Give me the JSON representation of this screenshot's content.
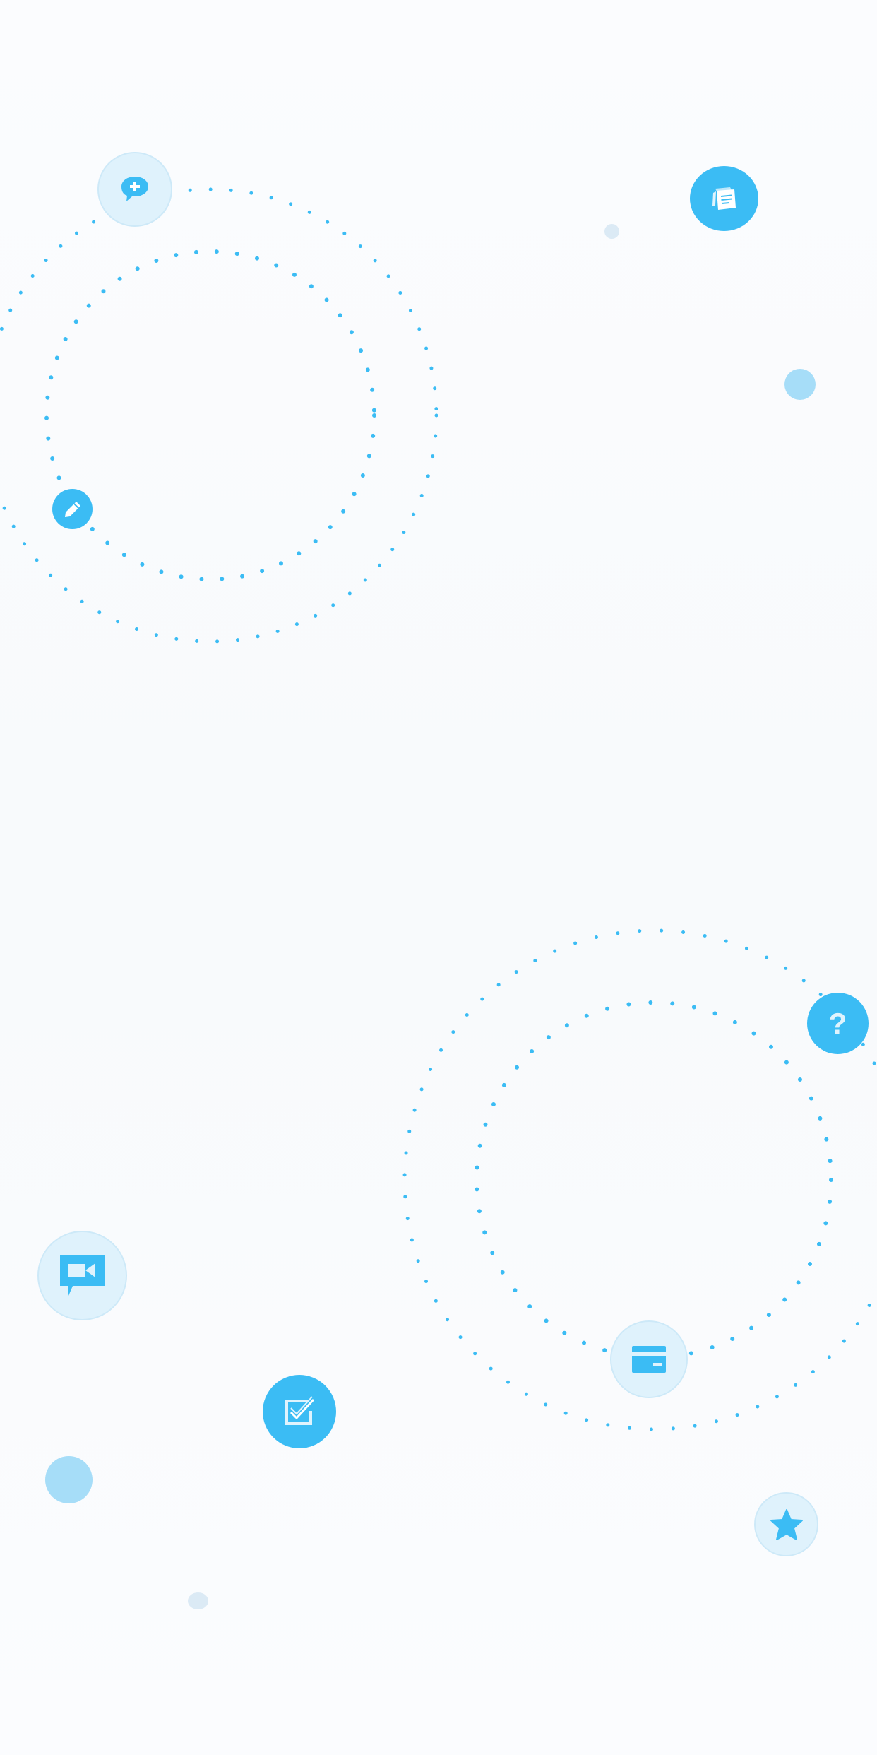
{
  "theme": {
    "accent": "#3bbcf4",
    "accent_light": "#a6ddf8",
    "pale_fill": "#dff2fc",
    "background": "#f9fbfd"
  },
  "icons": [
    "add-comment-icon",
    "notes-icon",
    "pencil-icon",
    "help-icon",
    "video-chat-icon",
    "checklist-icon",
    "credit-card-icon",
    "star-icon"
  ],
  "help_icon": {
    "glyph": "?"
  }
}
